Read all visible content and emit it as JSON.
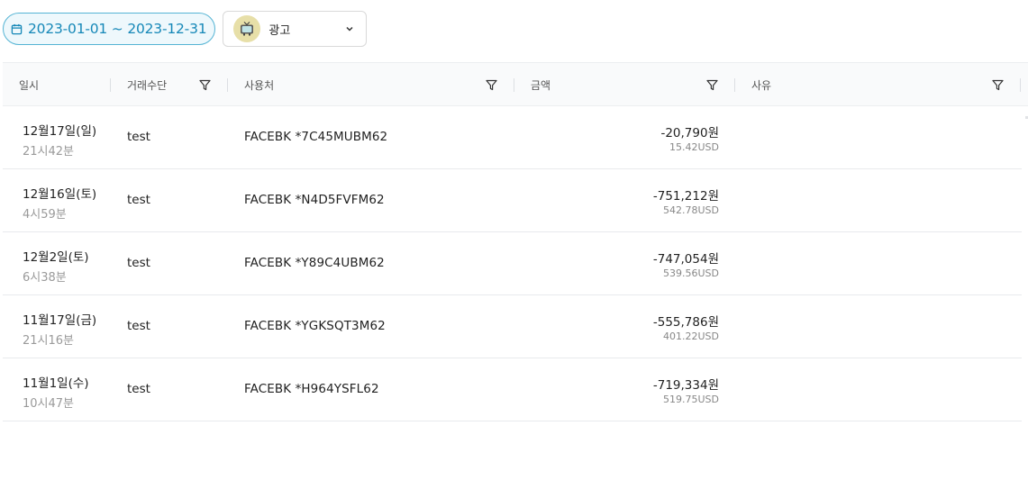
{
  "filters": {
    "date_range": "2023-01-01 ~ 2023-12-31",
    "category": {
      "label": "광고",
      "icon": "tv-icon",
      "badge_color": "#e7dfa8"
    }
  },
  "accent_color": "#1688b8",
  "table": {
    "columns": [
      {
        "key": "datetime",
        "label": "일시",
        "filter": false
      },
      {
        "key": "method",
        "label": "거래수단",
        "filter": true
      },
      {
        "key": "merchant",
        "label": "사용처",
        "filter": true
      },
      {
        "key": "amount",
        "label": "금액",
        "filter": true
      },
      {
        "key": "reason",
        "label": "사유",
        "filter": true
      }
    ],
    "rows": [
      {
        "date": "12월17일(일)",
        "time": "21시42분",
        "method": "test",
        "merchant": "FACEBK *7C45MUBM62",
        "amount_krw": "-20,790원",
        "amount_usd": "15.42USD",
        "reason": ""
      },
      {
        "date": "12월16일(토)",
        "time": "4시59분",
        "method": "test",
        "merchant": "FACEBK *N4D5FVFM62",
        "amount_krw": "-751,212원",
        "amount_usd": "542.78USD",
        "reason": ""
      },
      {
        "date": "12월2일(토)",
        "time": "6시38분",
        "method": "test",
        "merchant": "FACEBK *Y89C4UBM62",
        "amount_krw": "-747,054원",
        "amount_usd": "539.56USD",
        "reason": ""
      },
      {
        "date": "11월17일(금)",
        "time": "21시16분",
        "method": "test",
        "merchant": "FACEBK *YGKSQT3M62",
        "amount_krw": "-555,786원",
        "amount_usd": "401.22USD",
        "reason": ""
      },
      {
        "date": "11월1일(수)",
        "time": "10시47분",
        "method": "test",
        "merchant": "FACEBK *H964YSFL62",
        "amount_krw": "-719,334원",
        "amount_usd": "519.75USD",
        "reason": ""
      }
    ]
  }
}
